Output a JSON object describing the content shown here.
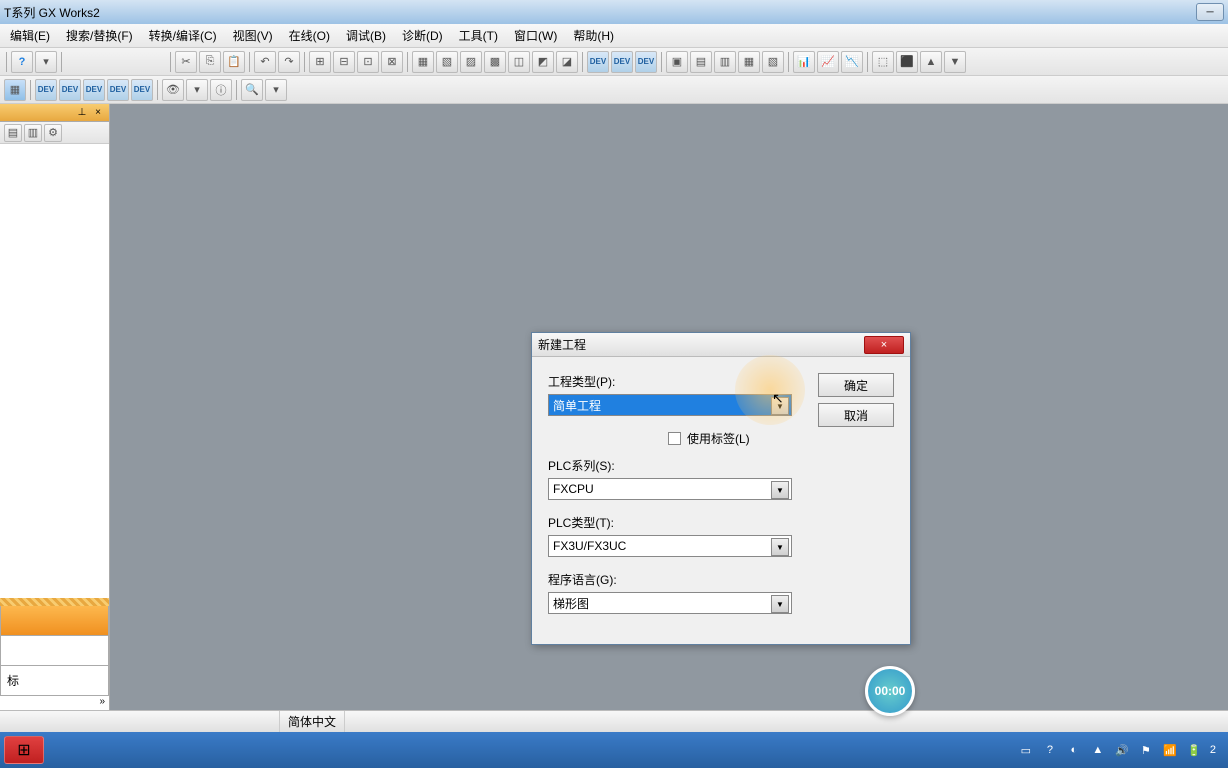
{
  "titlebar": {
    "text": "T系列 GX Works2"
  },
  "menubar": {
    "items": [
      "编辑(E)",
      "搜索/替换(F)",
      "转换/编译(C)",
      "视图(V)",
      "在线(O)",
      "调试(B)",
      "诊断(D)",
      "工具(T)",
      "窗口(W)",
      "帮助(H)"
    ]
  },
  "sidebar": {
    "tabs": [
      "",
      "标"
    ],
    "pin": "⊥",
    "close": "×"
  },
  "dialog": {
    "title": "新建工程",
    "close": "×",
    "ok_label": "确定",
    "cancel_label": "取消",
    "project_type_label": "工程类型(P):",
    "project_type_value": "简单工程",
    "use_label_text": "使用标签(L)",
    "plc_series_label": "PLC系列(S):",
    "plc_series_value": "FXCPU",
    "plc_type_label": "PLC类型(T):",
    "plc_type_value": "FX3U/FX3UC",
    "program_lang_label": "程序语言(G):",
    "program_lang_value": "梯形图"
  },
  "statusbar": {
    "lang": "简体中文"
  },
  "video_badge": "00:00",
  "taskbar": {
    "time": "2"
  }
}
